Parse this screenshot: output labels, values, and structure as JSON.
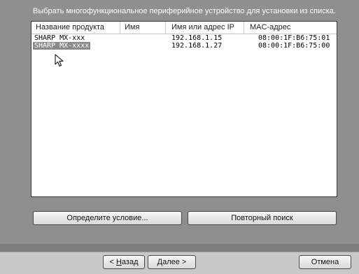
{
  "instruction": "Выбрать многофункциональное периферийное устройство для установки из списка.",
  "columns": [
    "Название продукта",
    "Имя",
    "Имя или адрес IP",
    "MAC-адрес"
  ],
  "rows": [
    {
      "product": "SHARP MX-xxx",
      "name": "",
      "ip": "192.168.1.15",
      "mac": "08:00:1F:B6:75:01",
      "selected": false
    },
    {
      "product": "SHARP MX-xxxx",
      "name": "",
      "ip": "192.168.1.27",
      "mac": "08:00:1F:B6:75:00",
      "selected": true
    }
  ],
  "buttons": {
    "specify_condition": "Определите условие...",
    "re_search": "Повторный поиск",
    "back_prefix": "< ",
    "back_mnemonic": "Н",
    "back_rest": "азад",
    "next_mnemonic": "Д",
    "next_rest": "алее >",
    "cancel": "Отмена"
  },
  "icons": {
    "cursor": "mouse-pointer-icon"
  }
}
